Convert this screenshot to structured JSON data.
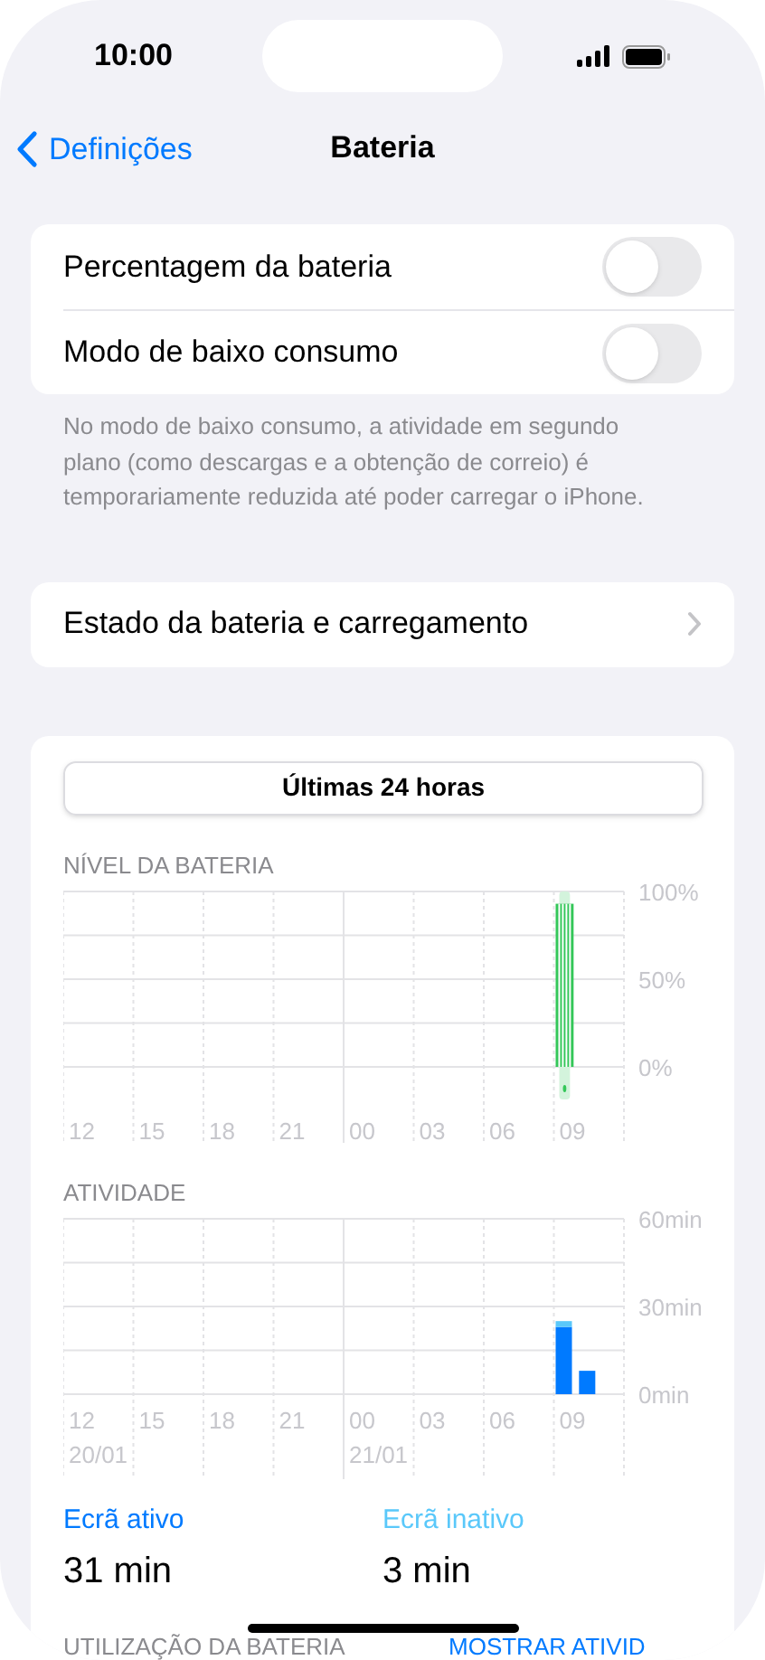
{
  "status_bar": {
    "time": "10:00"
  },
  "nav": {
    "back": "Definições",
    "title": "Bateria"
  },
  "toggles": [
    {
      "label": "Percentagem da bateria",
      "on": false
    },
    {
      "label": "Modo de baixo consumo",
      "on": false
    }
  ],
  "footnote": "No modo de baixo consumo, a atividade em segundo plano (como descargas e a obtenção de correio) é temporariamente reduzida até poder carregar o iPhone.",
  "health_row": {
    "label": "Estado da bateria e carregamento"
  },
  "range_button": "Últimas 24 horas",
  "battery_chart": {
    "title": "NÍVEL DA BATERIA",
    "chart_data": {
      "type": "bar",
      "categories": [
        "12",
        null,
        null,
        "15",
        null,
        null,
        "18",
        null,
        null,
        "21",
        null,
        null,
        "00",
        null,
        null,
        "03",
        null,
        null,
        "06",
        null,
        null,
        "09",
        null,
        null
      ],
      "series": [
        {
          "color": "#34c759",
          "values": [
            null,
            null,
            null,
            null,
            null,
            null,
            null,
            null,
            null,
            null,
            null,
            null,
            null,
            null,
            null,
            null,
            null,
            null,
            null,
            null,
            null,
            93,
            null,
            null
          ]
        }
      ],
      "ylim": [
        0,
        100
      ],
      "yticks": [
        {
          "value": 100,
          "label": "100%"
        },
        {
          "value": 50,
          "label": "50%"
        },
        {
          "value": 0,
          "label": "0%"
        }
      ]
    }
  },
  "activity_chart": {
    "title": "ATIVIDADE",
    "dates": [
      "20/01",
      "21/01"
    ],
    "chart_data": {
      "type": "bar",
      "stacked": true,
      "categories": [
        "12",
        null,
        null,
        "15",
        null,
        null,
        "18",
        null,
        null,
        "21",
        null,
        null,
        "00",
        null,
        null,
        "03",
        null,
        null,
        "06",
        null,
        null,
        "09",
        null,
        null
      ],
      "series": [
        {
          "color": "#007aff",
          "values": [
            null,
            null,
            null,
            null,
            null,
            null,
            null,
            null,
            null,
            null,
            null,
            null,
            null,
            null,
            null,
            null,
            null,
            null,
            null,
            null,
            null,
            23,
            8,
            null
          ]
        },
        {
          "color": "#5ac8fa",
          "values": [
            null,
            null,
            null,
            null,
            null,
            null,
            null,
            null,
            null,
            null,
            null,
            null,
            null,
            null,
            null,
            null,
            null,
            null,
            null,
            null,
            null,
            2,
            null,
            null
          ]
        }
      ],
      "ylim": [
        0,
        60
      ],
      "yticks": [
        {
          "value": 60,
          "label": "60min"
        },
        {
          "value": 30,
          "label": "30min"
        },
        {
          "value": 0,
          "label": "0min"
        }
      ]
    }
  },
  "totals": [
    {
      "label": "Ecrã ativo",
      "value": "31 min",
      "color": "#007aff"
    },
    {
      "label": "Ecrã inativo",
      "value": "3 min",
      "color": "#5ac8fa"
    }
  ],
  "usage_header": {
    "title": "UTILIZAÇÃO DA BATERIA",
    "link": "MOSTRAR ATIVID"
  }
}
